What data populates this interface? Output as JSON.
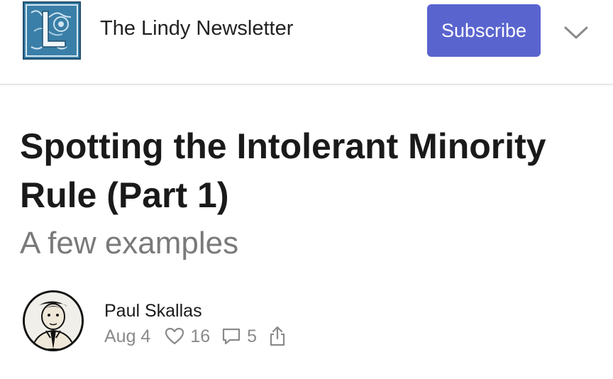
{
  "header": {
    "logo_icon": "illuminated-letter-L-logo",
    "publication_name": "The Lindy Newsletter",
    "subscribe_label": "Subscribe",
    "menu_icon": "chevron-down-icon"
  },
  "article": {
    "title": "Spotting the Intolerant Minority Rule (Part 1)",
    "subtitle": "A few examples",
    "author": "Paul Skallas",
    "date": "Aug 4",
    "likes": "16",
    "comments": "5"
  },
  "colors": {
    "accent": "#5a64cf",
    "subtitle_gray": "#7a7a7a",
    "meta_gray": "#8a8a8a",
    "logo_blue": "#2f6f95"
  }
}
